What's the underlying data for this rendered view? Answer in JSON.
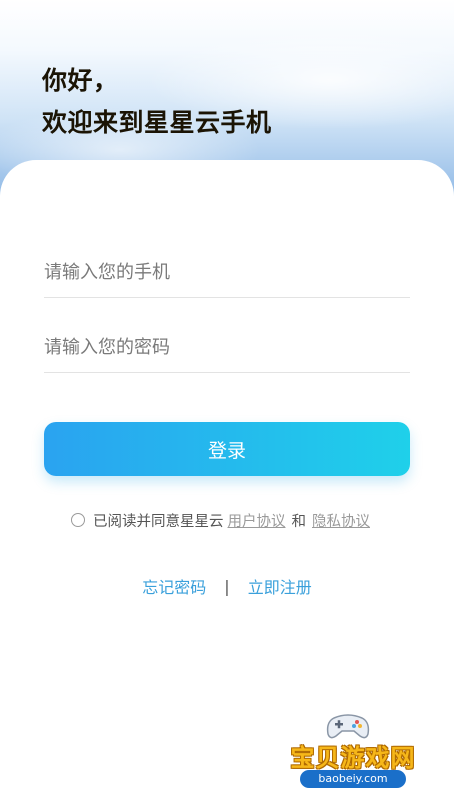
{
  "header": {
    "line1": "你好，",
    "line2": "欢迎来到星星云手机"
  },
  "form": {
    "phone_placeholder": "请输入您的手机",
    "password_placeholder": "请输入您的密码",
    "login_label": "登录"
  },
  "agreement": {
    "prefix": "已阅读并同意星星云",
    "user_agreement": "用户协议",
    "and": "和",
    "privacy_agreement": "隐私协议"
  },
  "links": {
    "forgot_password": "忘记密码",
    "separator": "|",
    "register": "立即注册"
  },
  "watermark": {
    "name": "宝贝游戏网",
    "domain": "baobeiy.com"
  },
  "colors": {
    "accent_start": "#2aa3f0",
    "accent_end": "#1fd0ea",
    "link": "#3aa0db"
  }
}
